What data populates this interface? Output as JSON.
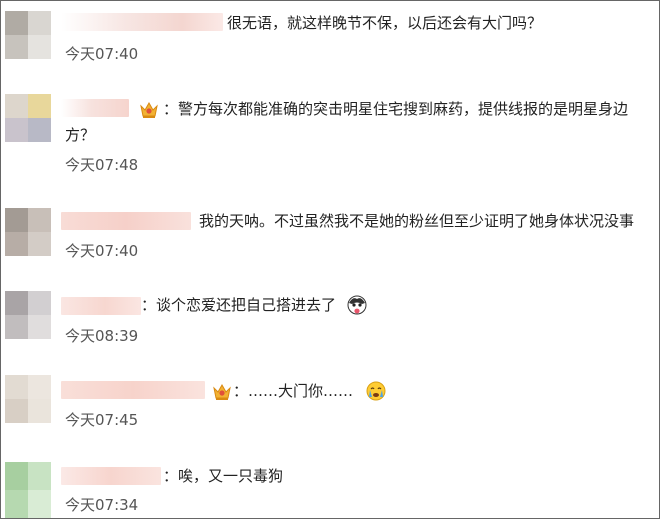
{
  "comments": [
    {
      "text": "很无语，就这样晚节不保，以后还会有大门吗？",
      "time": "今天07:40"
    },
    {
      "text": "：警方每次都能准确的突击明星住宅搜到麻药，提供线报的是明星身边",
      "text2": "方？",
      "time": "今天07:48",
      "badge": "vip-crown-icon"
    },
    {
      "text": "我的天呐。不过虽然我不是她的粉丝但至少证明了她身体状况没事",
      "time": "今天07:40"
    },
    {
      "text": "：谈个恋爱还把自己搭进去了",
      "time": "今天08:39",
      "emoji": "husky-tongue-emoji"
    },
    {
      "text": "：……大门你……",
      "time": "今天07:45",
      "badge": "vip-crown-icon",
      "emoji": "crying-face-emoji"
    },
    {
      "text": "：唉，又一只毒狗",
      "time": "今天07:34"
    }
  ],
  "colors": {
    "name_blur": "#f7d9d3",
    "avatar_1": [
      "#b0aba4",
      "#d9d6d1",
      "#c7c3bd",
      "#e5e3df"
    ],
    "avatar_2": [
      "#ddd6cc",
      "#e8d79b",
      "#c9c3cc",
      "#b8b9c6"
    ],
    "avatar_3": [
      "#a39b94",
      "#c8bfb8",
      "#b7ada6",
      "#d3ccc6"
    ],
    "avatar_4": [
      "#a9a4a6",
      "#d2cfd1",
      "#c1bdbe",
      "#e0dddd"
    ],
    "avatar_5": [
      "#e2dbd2",
      "#ece6df",
      "#d8cfc5",
      "#eae4dc"
    ],
    "avatar_6": [
      "#a7cfa0",
      "#c8e3c3",
      "#b6d9b0",
      "#d9ecd5"
    ]
  }
}
